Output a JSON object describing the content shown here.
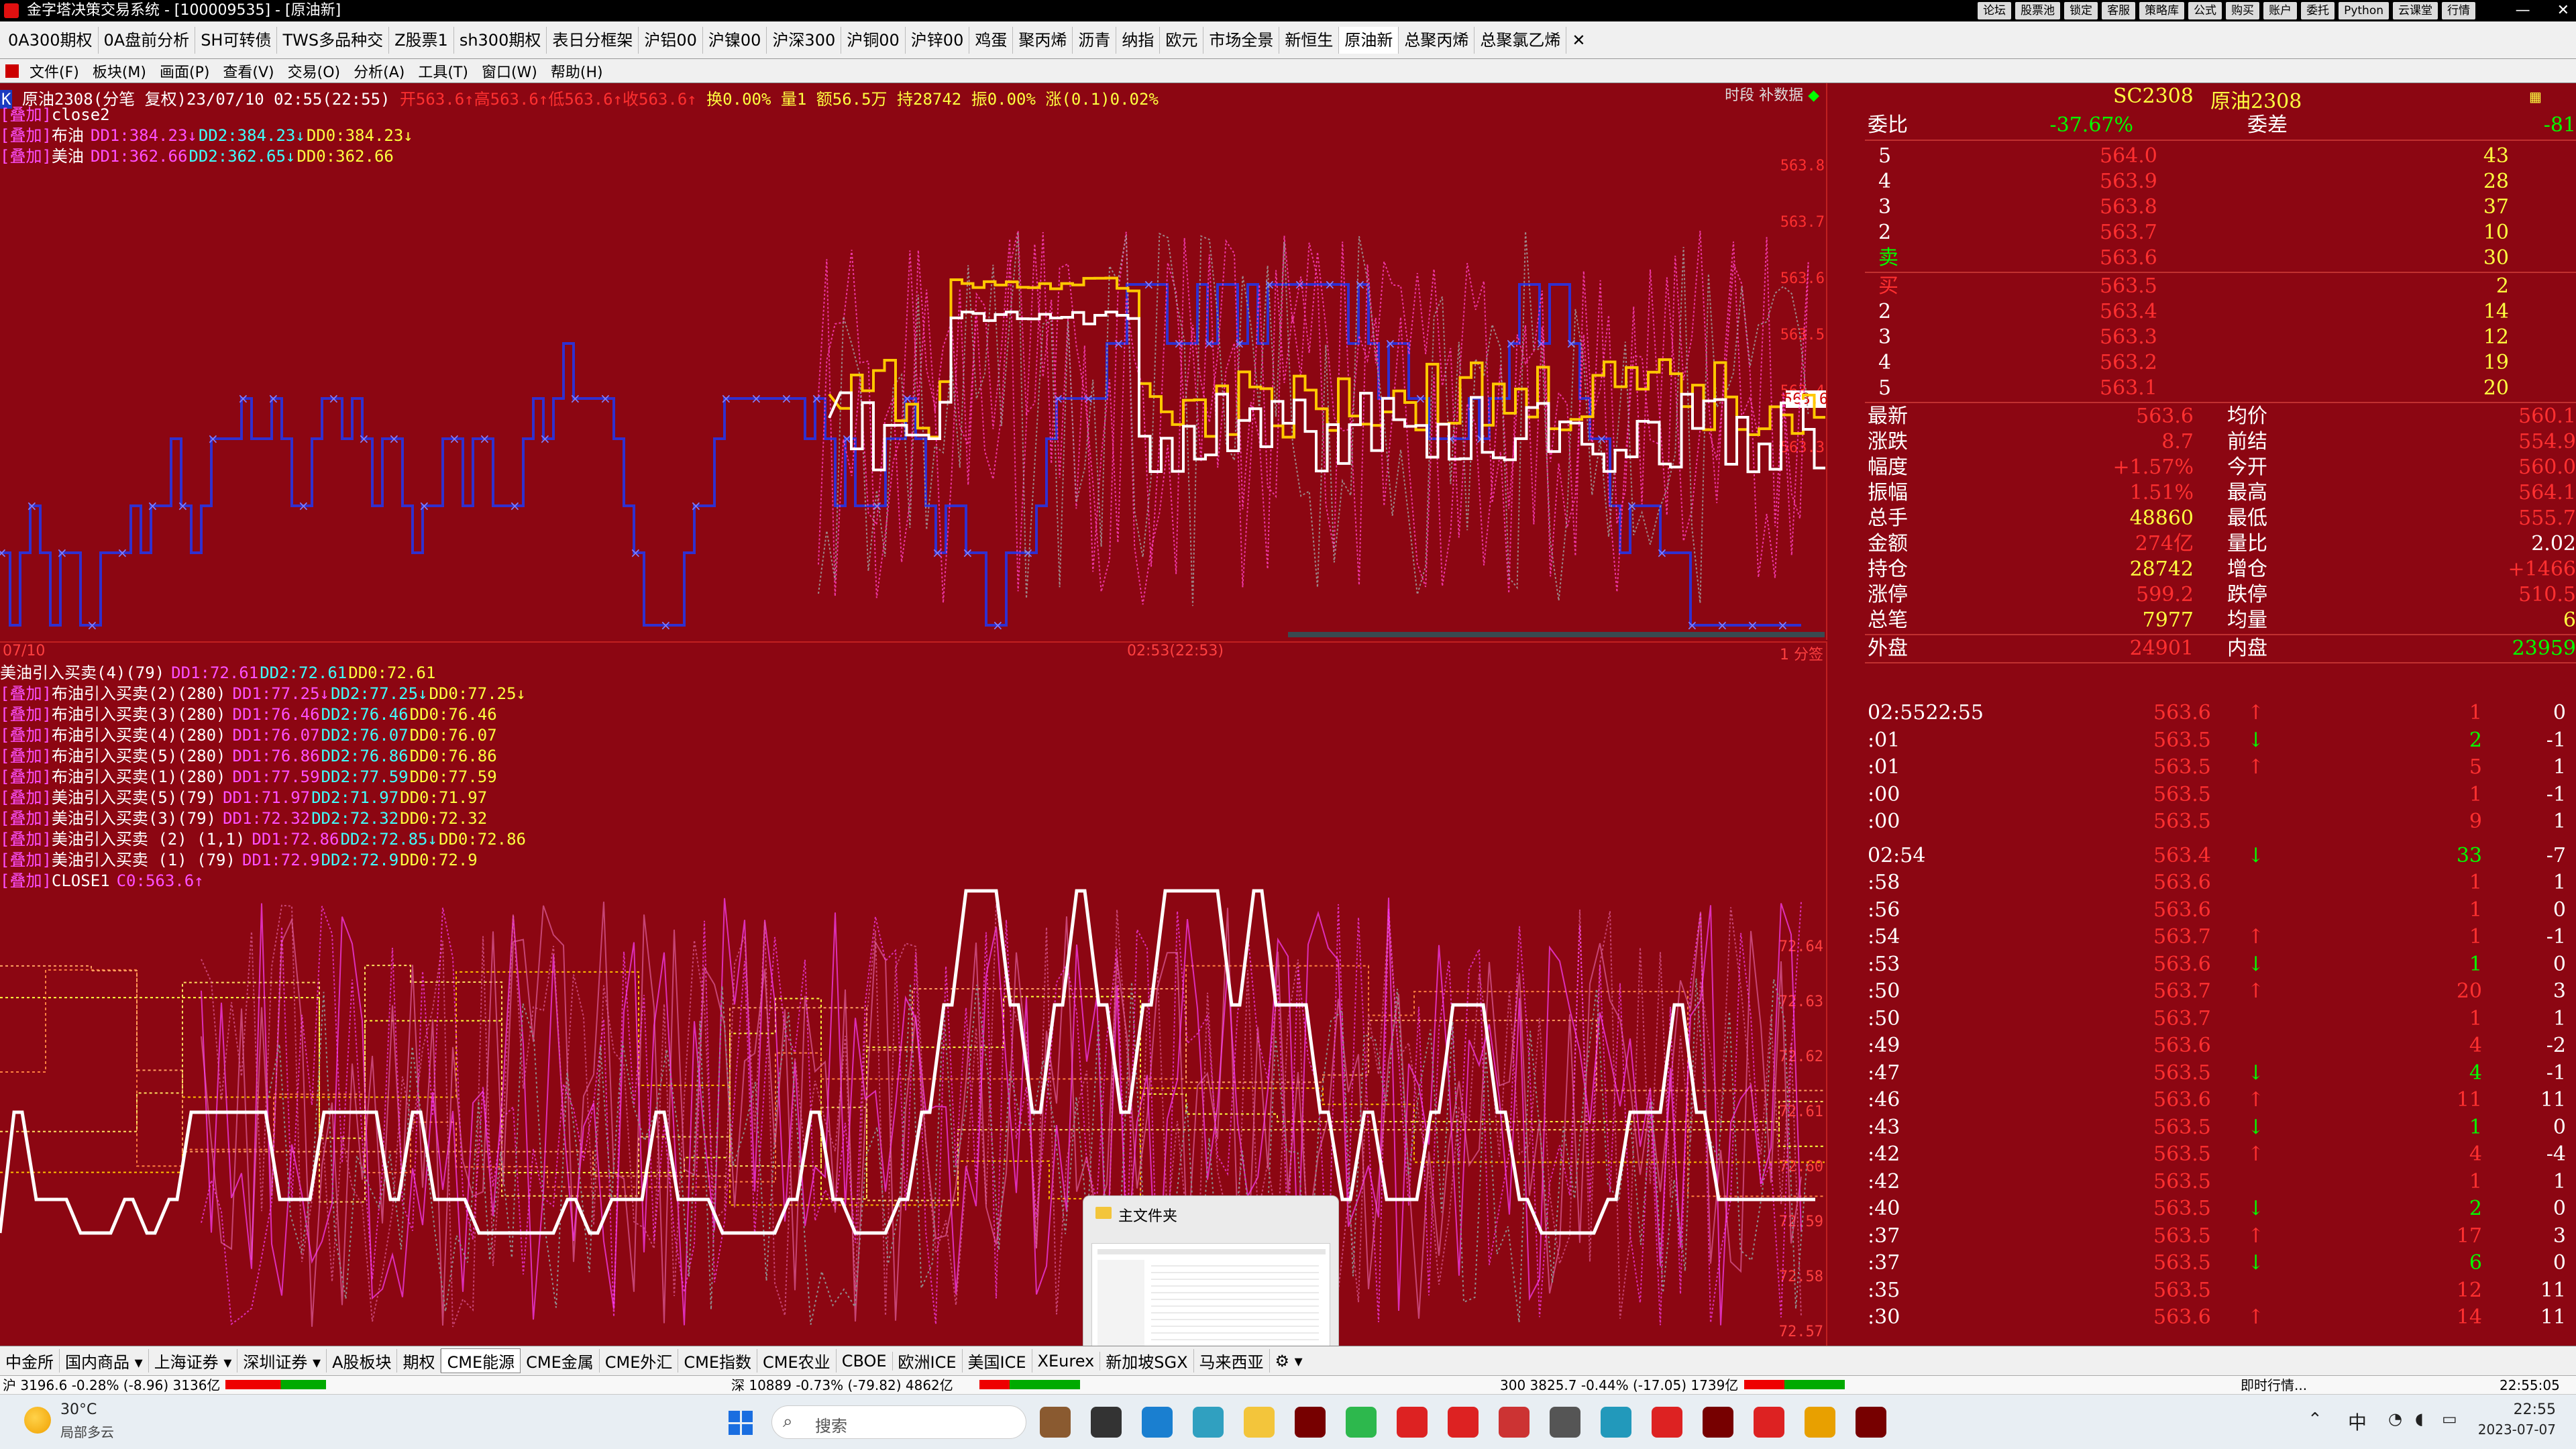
{
  "window": {
    "title": "金字塔决策交易系统 - [100009535] - [原油新]",
    "top_buttons": [
      "论坛",
      "股票池",
      "锁定",
      "客服",
      "策略库",
      "公式",
      "购买",
      "账户",
      "委托",
      "Python",
      "云课堂",
      "行情"
    ]
  },
  "tabs": [
    "0A300期权",
    "0A盘前分析",
    "SH可转债",
    "TWS多品种交",
    "Z股票1",
    "sh300期权",
    "表日分框架",
    "沪铝00",
    "沪镍00",
    "沪深300",
    "沪铜00",
    "沪锌00",
    "鸡蛋",
    "聚丙烯",
    "沥青",
    "纳指",
    "欧元",
    "市场全景",
    "新恒生",
    "原油新",
    "总聚丙烯",
    "总聚氯乙烯"
  ],
  "tab_close": "✕",
  "menu": [
    "文件(F)",
    "板块(M)",
    "画面(P)",
    "查看(V)",
    "交易(O)",
    "分析(A)",
    "工具(T)",
    "窗口(W)",
    "帮助(H)"
  ],
  "main_chart": {
    "header": "原油2308(分笔 复权)23/07/10 02:55(22:55)",
    "header_stats": "开563.6↑高563.6↑低563.6↑收563.6↑",
    "header_stats2": "换0.00% 量1 额56.5万 持28742 振0.00% 涨(0.1)0.02%",
    "top_right": "时段  补数据",
    "legend": [
      {
        "tag": "[叠加]",
        "text": "close2"
      },
      {
        "tag": "[叠加]",
        "name": "布油",
        "v1": "DD1:384.23↓",
        "v2": "DD2:384.23↓",
        "v3": "DD0:384.23↓"
      },
      {
        "tag": "[叠加]",
        "name": "美油",
        "v1": "DD1:362.66",
        "v2": "DD2:362.65↓",
        "v3": "DD0:362.66"
      }
    ],
    "y_ticks": [
      "563.8",
      "563.7",
      "563.6",
      "563.5",
      "563.4",
      "563.3"
    ],
    "current_price": "563.6"
  },
  "lower_chart": {
    "date_label": "07/10",
    "time_label": "02:53(22:53)",
    "corner": "1 分签",
    "legend": [
      {
        "tag": "",
        "name": "美油引入买卖(4)(79)",
        "v1": "DD1:72.61",
        "v2": "DD2:72.61",
        "v3": "DD0:72.61"
      },
      {
        "tag": "[叠加]",
        "name": "布油引入买卖(2)(280)",
        "v1": "DD1:77.25↓",
        "v2": "DD2:77.25↓",
        "v3": "DD0:77.25↓"
      },
      {
        "tag": "[叠加]",
        "name": "布油引入买卖(3)(280)",
        "v1": "DD1:76.46",
        "v2": "DD2:76.46",
        "v3": "DD0:76.46"
      },
      {
        "tag": "[叠加]",
        "name": "布油引入买卖(4)(280)",
        "v1": "DD1:76.07",
        "v2": "DD2:76.07",
        "v3": "DD0:76.07"
      },
      {
        "tag": "[叠加]",
        "name": "布油引入买卖(5)(280)",
        "v1": "DD1:76.86",
        "v2": "DD2:76.86",
        "v3": "DD0:76.86"
      },
      {
        "tag": "[叠加]",
        "name": "布油引入买卖(1)(280)",
        "v1": "DD1:77.59",
        "v2": "DD2:77.59",
        "v3": "DD0:77.59"
      },
      {
        "tag": "[叠加]",
        "name": "美油引入买卖(5)(79)",
        "v1": "DD1:71.97",
        "v2": "DD2:71.97",
        "v3": "DD0:71.97"
      },
      {
        "tag": "[叠加]",
        "name": "美油引入买卖(3)(79)",
        "v1": "DD1:72.32",
        "v2": "DD2:72.32",
        "v3": "DD0:72.32"
      },
      {
        "tag": "[叠加]",
        "name": "美油引入买卖 (2) (1,1)",
        "v1": "DD1:72.86",
        "v2": "DD2:72.85↓",
        "v3": "DD0:72.86"
      },
      {
        "tag": "[叠加]",
        "name": "美油引入买卖 (1) (79)",
        "v1": "DD1:72.9",
        "v2": "DD2:72.9",
        "v3": "DD0:72.9"
      },
      {
        "tag": "[叠加]",
        "name": "CLOSE1",
        "v1": "C0:563.6↑",
        "v2": "",
        "v3": ""
      }
    ],
    "y_ticks": [
      "72.64",
      "72.63",
      "72.62",
      "72.61",
      "72.60",
      "72.59",
      "72.58",
      "72.57"
    ]
  },
  "quote_panel": {
    "code": "SC2308",
    "name": "原油2308",
    "weibi_label": "委比",
    "weibi": "-37.67%",
    "weicha_label": "委差",
    "weicha": "-81",
    "asks": [
      {
        "lvl": "5",
        "price": "564.0",
        "vol": "43"
      },
      {
        "lvl": "4",
        "price": "563.9",
        "vol": "28"
      },
      {
        "lvl": "3",
        "price": "563.8",
        "vol": "37"
      },
      {
        "lvl": "2",
        "price": "563.7",
        "vol": "10"
      },
      {
        "lvl": "卖",
        "price": "563.6",
        "vol": "30"
      }
    ],
    "bids": [
      {
        "lvl": "买",
        "price": "563.5",
        "vol": "2"
      },
      {
        "lvl": "2",
        "price": "563.4",
        "vol": "14"
      },
      {
        "lvl": "3",
        "price": "563.3",
        "vol": "12"
      },
      {
        "lvl": "4",
        "price": "563.2",
        "vol": "19"
      },
      {
        "lvl": "5",
        "price": "563.1",
        "vol": "20"
      }
    ],
    "stats": [
      {
        "l1": "最新",
        "v1": "563.6",
        "l2": "均价",
        "v2": "560.1"
      },
      {
        "l1": "涨跌",
        "v1": "8.7",
        "l2": "前结",
        "v2": "554.9"
      },
      {
        "l1": "幅度",
        "v1": "+1.57%",
        "l2": "今开",
        "v2": "560.0"
      },
      {
        "l1": "振幅",
        "v1": "1.51%",
        "l2": "最高",
        "v2": "564.1"
      },
      {
        "l1": "总手",
        "v1": "48860",
        "l2": "最低",
        "v2": "555.7"
      },
      {
        "l1": "金额",
        "v1": "274亿",
        "l2": "量比",
        "v2": "2.02"
      },
      {
        "l1": "持仓",
        "v1": "28742",
        "l2": "增仓",
        "v2": "+1466"
      },
      {
        "l1": "涨停",
        "v1": "599.2",
        "l2": "跌停",
        "v2": "510.5"
      },
      {
        "l1": "总笔",
        "v1": "7977",
        "l2": "均量",
        "v2": "6"
      }
    ],
    "outer_label": "外盘",
    "outer": "24901",
    "inner_label": "内盘",
    "inner": "23959",
    "ticks": [
      {
        "t": "02:5522:55",
        "p": "563.6",
        "a": "↑",
        "v": "1",
        "d": "0"
      },
      {
        "t": ":01",
        "p": "563.5",
        "a": "↓",
        "v": "2",
        "d": "-1"
      },
      {
        "t": ":01",
        "p": "563.5",
        "a": "↑",
        "v": "5",
        "d": "1"
      },
      {
        "t": ":00",
        "p": "563.5",
        "a": "",
        "v": "1",
        "d": "-1"
      },
      {
        "t": ":00",
        "p": "563.5",
        "a": "",
        "v": "9",
        "d": "1"
      },
      {
        "t": "02:54",
        "p": "563.4",
        "a": "↓",
        "v": "33",
        "d": "-7"
      },
      {
        "t": ":58",
        "p": "563.6",
        "a": "",
        "v": "1",
        "d": "1"
      },
      {
        "t": ":56",
        "p": "563.6",
        "a": "",
        "v": "1",
        "d": "0"
      },
      {
        "t": ":54",
        "p": "563.7",
        "a": "↑",
        "v": "1",
        "d": "-1"
      },
      {
        "t": ":53",
        "p": "563.6",
        "a": "↓",
        "v": "1",
        "d": "0"
      },
      {
        "t": ":50",
        "p": "563.7",
        "a": "↑",
        "v": "20",
        "d": "3"
      },
      {
        "t": ":50",
        "p": "563.7",
        "a": "",
        "v": "1",
        "d": "1"
      },
      {
        "t": ":49",
        "p": "563.6",
        "a": "",
        "v": "4",
        "d": "-2"
      },
      {
        "t": ":47",
        "p": "563.5",
        "a": "↓",
        "v": "4",
        "d": "-1"
      },
      {
        "t": ":46",
        "p": "563.6",
        "a": "↑",
        "v": "11",
        "d": "11"
      },
      {
        "t": ":43",
        "p": "563.5",
        "a": "↓",
        "v": "1",
        "d": "0"
      },
      {
        "t": ":42",
        "p": "563.5",
        "a": "↑",
        "v": "4",
        "d": "-4"
      },
      {
        "t": ":42",
        "p": "563.5",
        "a": "",
        "v": "1",
        "d": "1"
      },
      {
        "t": ":40",
        "p": "563.5",
        "a": "↓",
        "v": "2",
        "d": "0"
      },
      {
        "t": ":37",
        "p": "563.5",
        "a": "↑",
        "v": "17",
        "d": "3"
      },
      {
        "t": ":37",
        "p": "563.5",
        "a": "↓",
        "v": "6",
        "d": "0"
      },
      {
        "t": ":35",
        "p": "563.5",
        "a": "",
        "v": "12",
        "d": "11"
      },
      {
        "t": ":30",
        "p": "563.6",
        "a": "↑",
        "v": "14",
        "d": "11"
      }
    ]
  },
  "bottom_tabs": [
    "中金所",
    "国内商品 ▾",
    "上海证券 ▾",
    "深圳证券 ▾",
    "A股板块",
    "期权",
    "CME能源",
    "CME金属",
    "CME外汇",
    "CME指数",
    "CME农业",
    "CBOE",
    "欧洲ICE",
    "美国ICE",
    "XEurex",
    "新加坡SGX",
    "马来西亚"
  ],
  "status": {
    "sh": "沪 3196.6 -0.28% (-8.96) 3136亿",
    "sz": "深 10889 -0.73% (-79.82) 4862亿",
    "hs300": "300 3825.7 -0.44% (-17.05) 1739亿",
    "right": "即时行情...",
    "time": "22:55:05"
  },
  "taskbar": {
    "weather_temp": "30°C",
    "weather_desc": "局部多云",
    "search": "搜索",
    "ime": "中",
    "clock_time": "22:55",
    "clock_date": "2023-07-07"
  },
  "popup": {
    "title": "主文件夹"
  },
  "colors": {
    "bg": "#8c0612",
    "up": "#ff3030",
    "down": "#00e000",
    "white_line": "#ffffff",
    "yellow_line": "#ffc800",
    "blue_line": "#3030d0",
    "magenta": "#ff40ff"
  }
}
